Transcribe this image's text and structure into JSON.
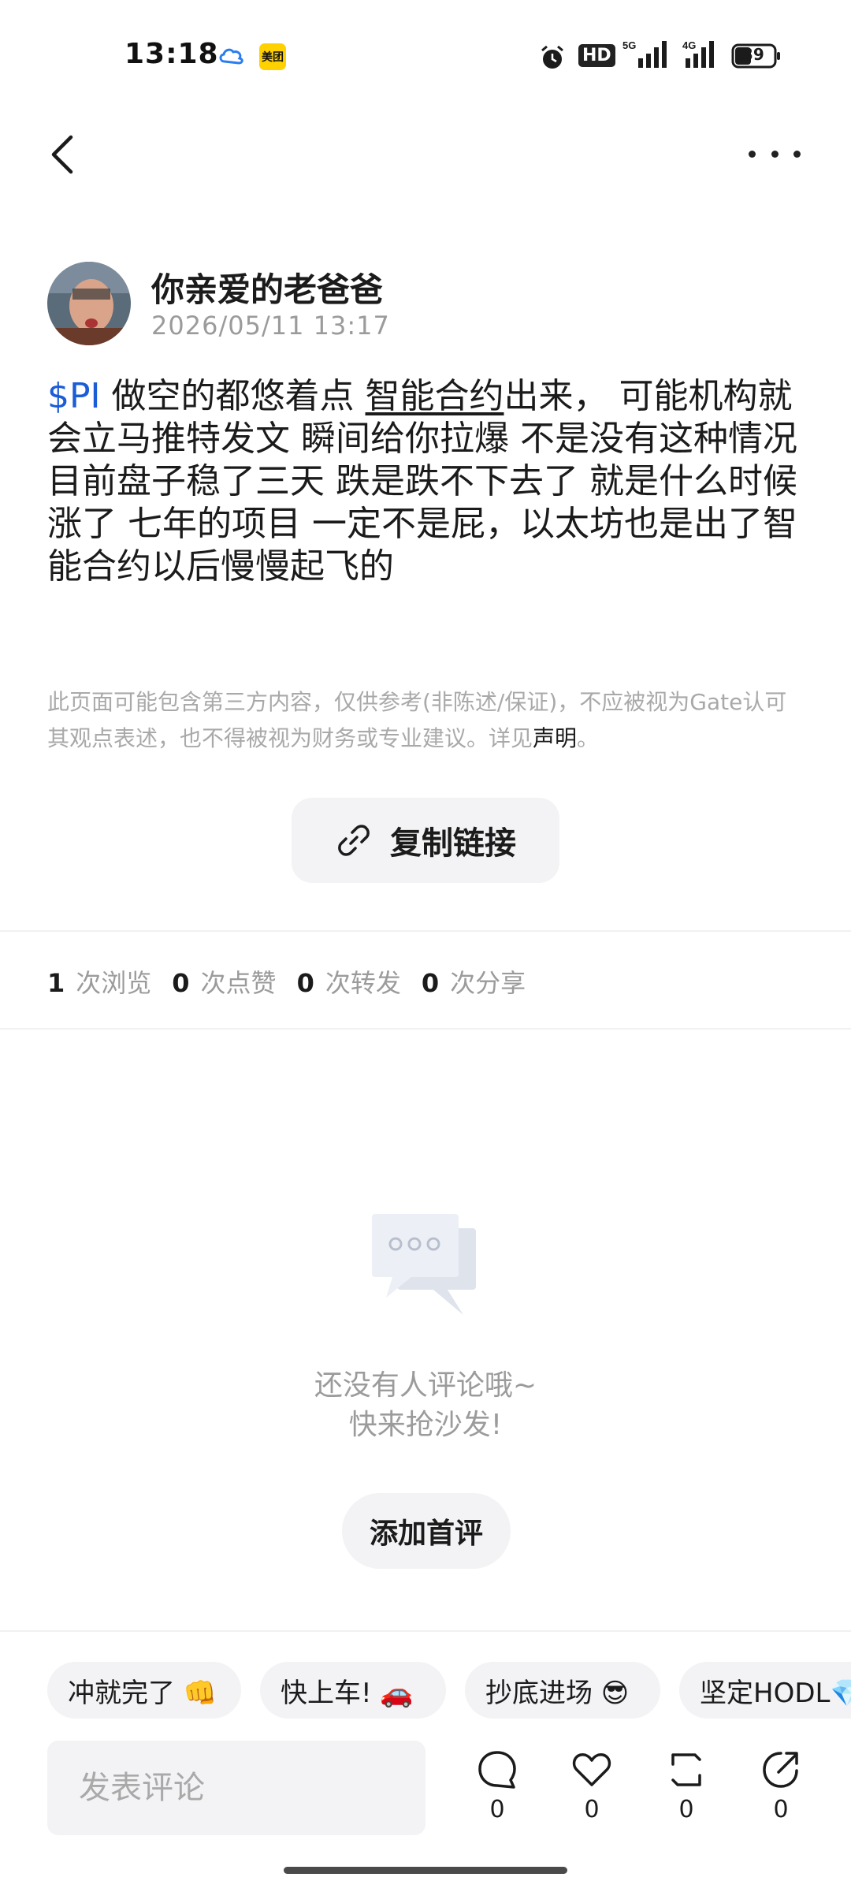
{
  "status_bar": {
    "time": "13:18",
    "meituan_label": "美团",
    "hd_label": "HD",
    "battery": "39",
    "icons": [
      "cloud-icon",
      "alarm-icon",
      "signal-5g-icon",
      "signal-4g-icon",
      "battery-icon"
    ]
  },
  "header": {
    "back_icon": "chevron-left-icon",
    "more_icon": "more-dots-icon"
  },
  "author": {
    "name": "你亲爱的老爸爸",
    "time": "2026/05/11 13:17"
  },
  "post": {
    "ticker": "$PI",
    "text_1": " 做空的都悠着点 ",
    "text_link": "智能合约",
    "text_2": "出来，   可能机构就会立马推特发文 瞬间给你拉爆  不是没有这种情况 目前盘子稳了三天 跌是跌不下去了 就是什么时候涨了 七年的项目 一定不是屁，以太坊也是出了智能合约以后慢慢起飞的"
  },
  "disclaimer": {
    "text": "此页面可能包含第三方内容，仅供参考(非陈述/保证)，不应被视为Gate认可其观点表述，也不得被视为财务或专业建议。详见",
    "link": "声明",
    "end": "。"
  },
  "copy_link": {
    "label": "复制链接",
    "icon": "link-icon"
  },
  "stats": {
    "views": "1",
    "views_label": "次浏览",
    "likes": "0",
    "likes_label": "次点赞",
    "reposts": "0",
    "reposts_label": "次转发",
    "shares": "0",
    "shares_label": "次分享"
  },
  "empty_state": {
    "line1": "还没有人评论哦~",
    "line2": "快来抢沙发!",
    "button": "添加首评"
  },
  "quick_replies": [
    "冲就完了 👊",
    "快上车! 🚗",
    "抄底进场 😎",
    "坚定HODL💎"
  ],
  "composer": {
    "placeholder": "发表评论",
    "comment_count": "0",
    "like_count": "0",
    "repost_count": "0",
    "share_count": "0"
  },
  "colors": {
    "ticker": "#1a5dd6",
    "muted": "#9b9b9b",
    "chip_bg": "#f3f3f5"
  }
}
